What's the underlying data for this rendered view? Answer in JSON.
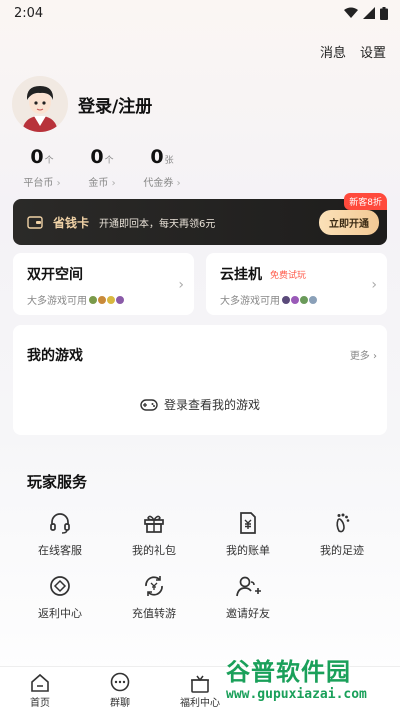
{
  "status": {
    "time": "2:04"
  },
  "header": {
    "messages": "消息",
    "settings": "设置"
  },
  "profile": {
    "login": "登录/注册"
  },
  "stats": [
    {
      "num": "0",
      "unit": "个",
      "label": "平台币"
    },
    {
      "num": "0",
      "unit": "个",
      "label": "金币"
    },
    {
      "num": "0",
      "unit": "张",
      "label": "代金券"
    }
  ],
  "vip": {
    "badge": "新客8折",
    "title": "省钱卡",
    "desc": "开通即回本，每天再领6元",
    "button": "立即开通"
  },
  "features": {
    "dual": {
      "title": "双开空间",
      "subtitle": "大多游戏可用"
    },
    "cloud": {
      "title": "云挂机",
      "tag": "免费试玩",
      "subtitle": "大多游戏可用"
    }
  },
  "games": {
    "title": "我的游戏",
    "more": "更多",
    "login_prompt": "登录查看我的游戏"
  },
  "services": {
    "title": "玩家服务",
    "items": [
      {
        "label": "在线客服",
        "icon": "headset-icon"
      },
      {
        "label": "我的礼包",
        "icon": "gift-icon"
      },
      {
        "label": "我的账单",
        "icon": "bill-icon"
      },
      {
        "label": "我的足迹",
        "icon": "footprint-icon"
      },
      {
        "label": "返利中心",
        "icon": "rebate-icon"
      },
      {
        "label": "充值转游",
        "icon": "transfer-icon"
      },
      {
        "label": "邀请好友",
        "icon": "invite-icon"
      }
    ]
  },
  "tabs": [
    {
      "label": "首页",
      "icon": "home-icon"
    },
    {
      "label": "群聊",
      "icon": "chat-icon"
    },
    {
      "label": "福利中心",
      "icon": "welfare-icon"
    }
  ],
  "watermark": {
    "brand": "谷普软件园",
    "url": "www.gupuxiazai.com"
  },
  "colors": {
    "accent": "#f3c995",
    "badge": "#ff4a3c",
    "tag": "#ff5a4a",
    "watermark": "#1aa05a"
  }
}
